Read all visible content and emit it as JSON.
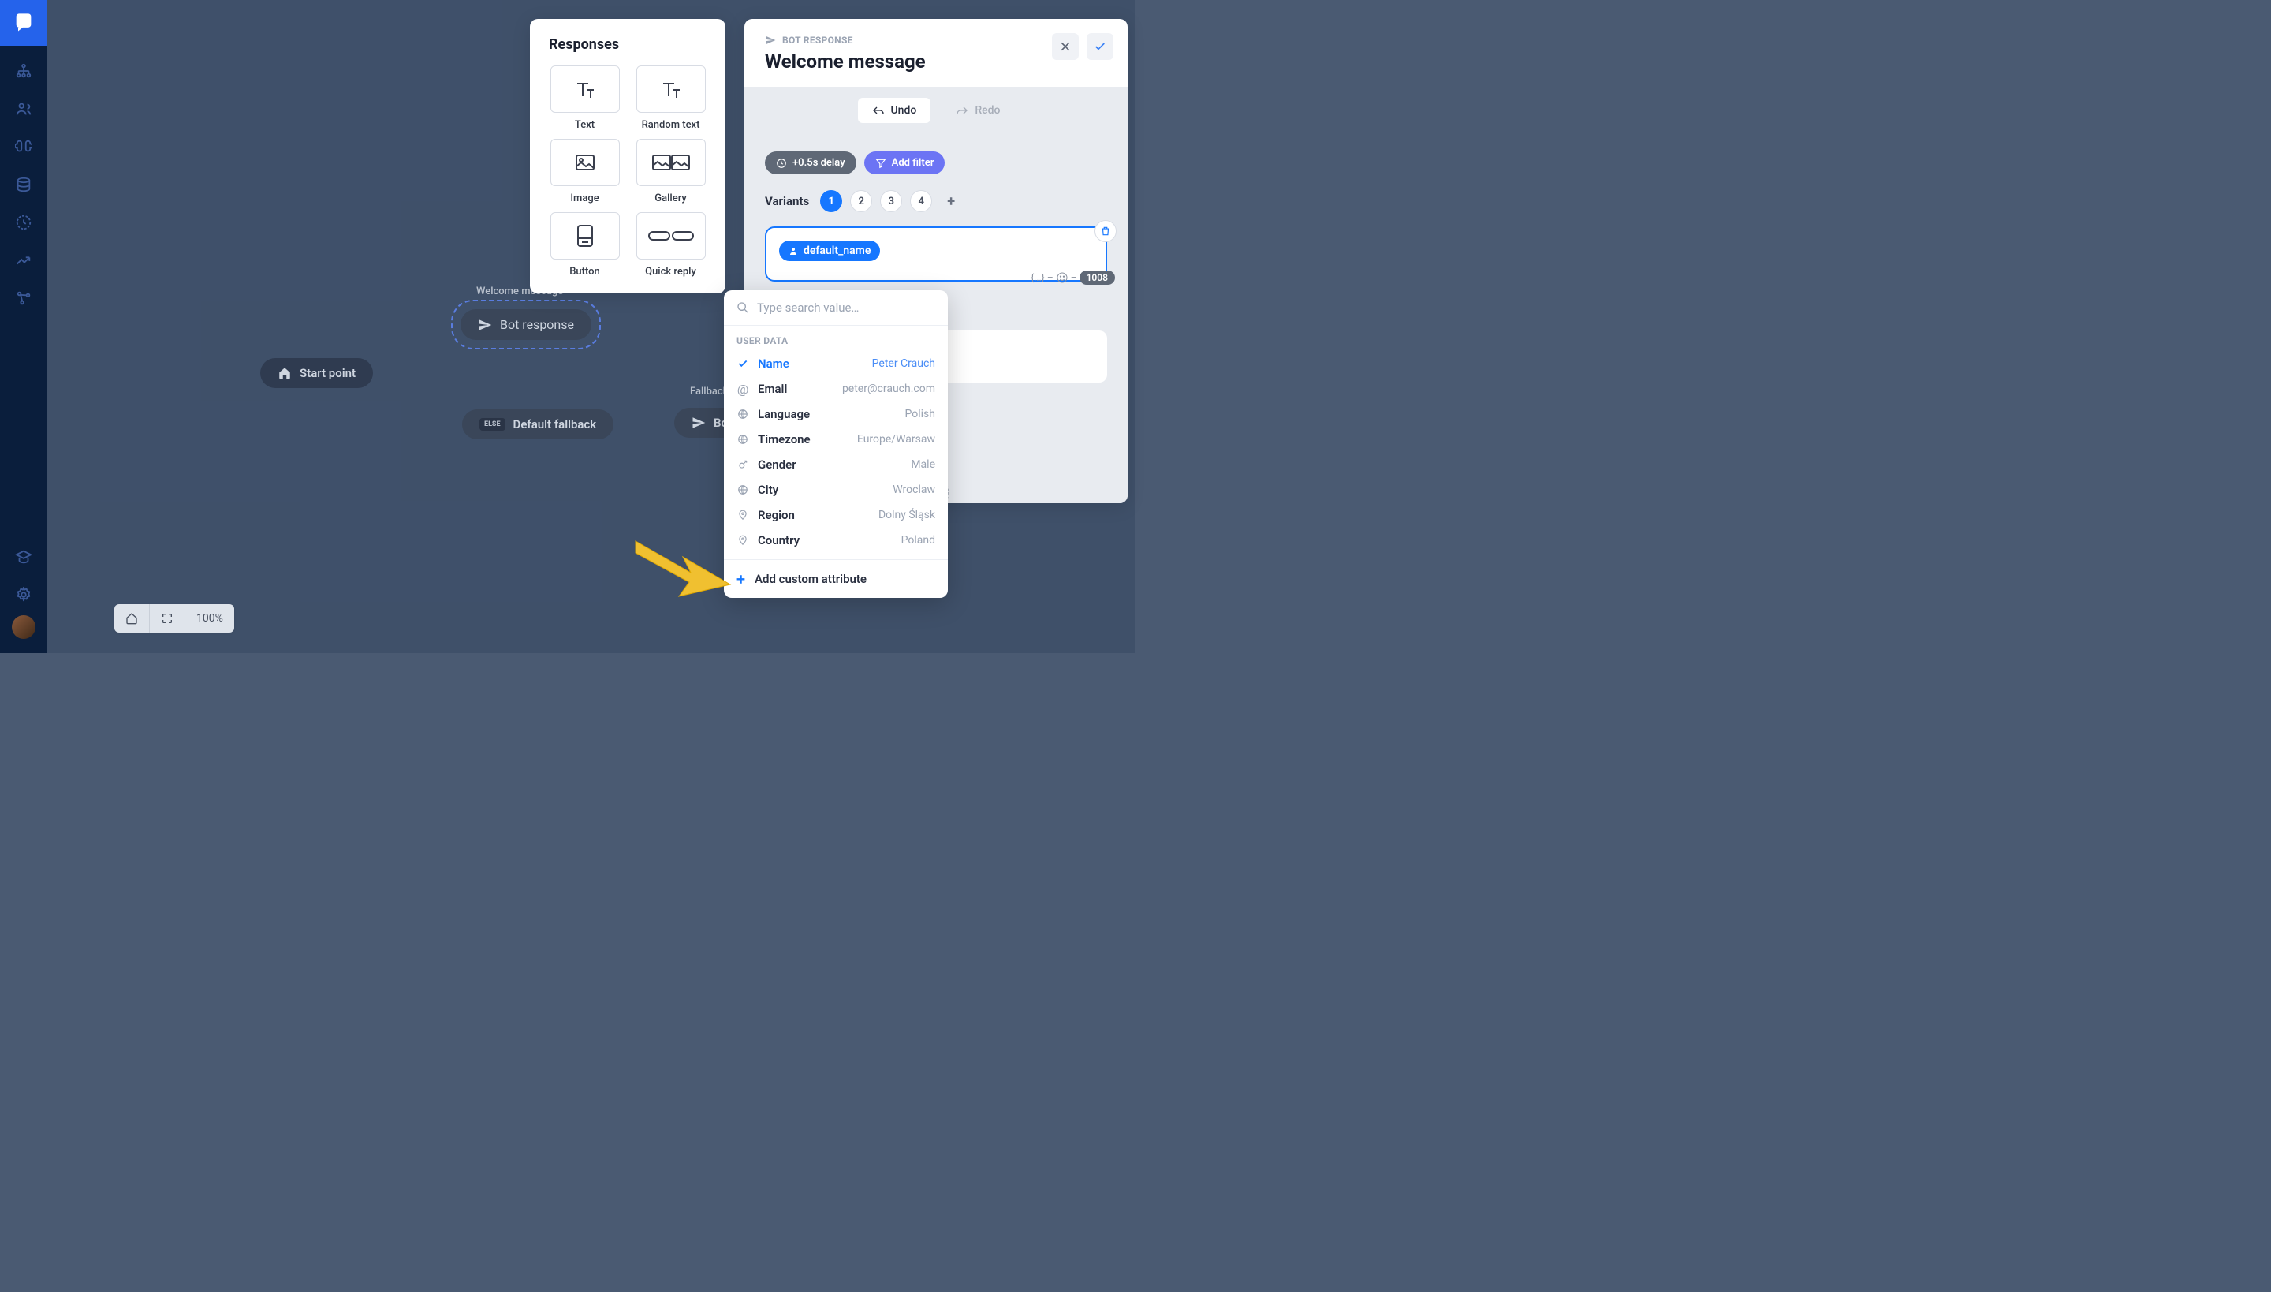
{
  "sidebar": {
    "items": [
      "org",
      "users",
      "brain",
      "db",
      "clock",
      "trend",
      "nodes"
    ],
    "bottom": [
      "grad",
      "gear"
    ]
  },
  "canvas": {
    "nodes": {
      "start": "Start point",
      "welcome_label": "Welcome message",
      "welcome_btn": "Bot response",
      "fallback_else": "ELSE",
      "fallback_btn": "Default fallback",
      "fallback2_label": "Fallback message",
      "fallback2_btn": "Bot respons"
    },
    "zoom": "100%"
  },
  "responses": {
    "title": "Responses",
    "items": [
      {
        "label": "Text"
      },
      {
        "label": "Random text"
      },
      {
        "label": "Image"
      },
      {
        "label": "Gallery"
      },
      {
        "label": "Button"
      },
      {
        "label": "Quick reply"
      }
    ]
  },
  "inspector": {
    "kicker": "BOT RESPONSE",
    "title": "Welcome message",
    "undo": "Undo",
    "redo": "Redo",
    "delay": "+0.5s delay",
    "filter": "Add filter",
    "variants_label": "Variants",
    "variants": [
      "1",
      "2",
      "3",
      "4"
    ],
    "token": "default_name",
    "char_count": "1008",
    "braces": "{...}"
  },
  "dropdown": {
    "search_placeholder": "Type search value…",
    "section": "USER DATA",
    "items": [
      {
        "label": "Name",
        "value": "Peter Crauch",
        "selected": true,
        "icon": "check"
      },
      {
        "label": "Email",
        "value": "peter@crauch.com",
        "icon": "at"
      },
      {
        "label": "Language",
        "value": "Polish",
        "icon": "globe"
      },
      {
        "label": "Timezone",
        "value": "Europe/Warsaw",
        "icon": "globe"
      },
      {
        "label": "Gender",
        "value": "Male",
        "icon": "gender"
      },
      {
        "label": "City",
        "value": "Wroclaw",
        "icon": "globe"
      },
      {
        "label": "Region",
        "value": "Dolny Śląsk",
        "icon": "pin"
      },
      {
        "label": "Country",
        "value": "Poland",
        "icon": "pin"
      }
    ],
    "footer": "Add custom attribute"
  }
}
